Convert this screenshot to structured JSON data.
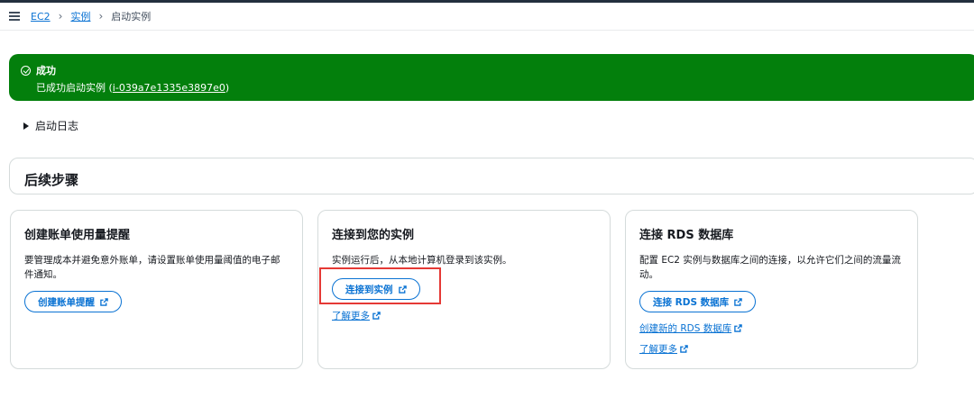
{
  "breadcrumb": {
    "items": [
      "EC2",
      "实例"
    ],
    "current": "启动实例"
  },
  "flash": {
    "title": "成功",
    "body_prefix": "已成功启动实例 (",
    "instance_id": "i-039a7e1335e3897e0",
    "body_suffix": ")"
  },
  "log_toggle": "启动日志",
  "next_steps": {
    "title": "后续步骤"
  },
  "cards": [
    {
      "title": "创建账单使用量提醒",
      "desc": "要管理成本并避免意外账单，请设置账单使用量阈值的电子邮件通知。",
      "button": "创建账单提醒"
    },
    {
      "title": "连接到您的实例",
      "desc": "实例运行后，从本地计算机登录到该实例。",
      "button": "连接到实例",
      "link": "了解更多"
    },
    {
      "title": "连接 RDS 数据库",
      "desc": "配置 EC2 实例与数据库之间的连接，以允许它们之间的流量流动。",
      "button": "连接 RDS 数据库",
      "link1": "创建新的 RDS 数据库",
      "link2": "了解更多"
    }
  ],
  "colors": {
    "success": "#037f0c",
    "link": "#0972d3",
    "highlight": "#e53935"
  }
}
